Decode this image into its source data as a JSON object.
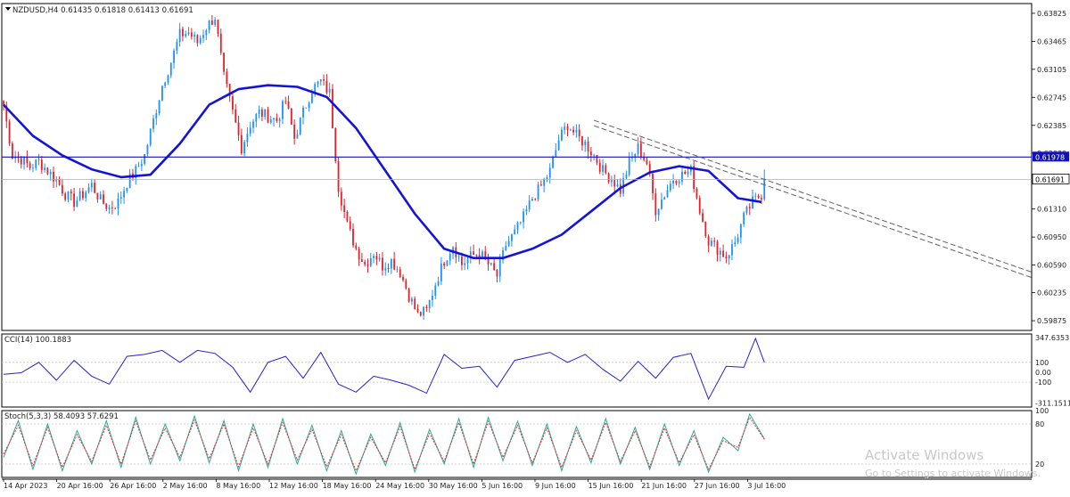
{
  "window": {
    "symbol_header": "NZDUSD,H4  0.61435 0.61818 0.61413 0.61691",
    "cci_header": "CCI(14) 100.1883",
    "stoch_header": "Stoch(5,3,3) 58.4093 57.6291"
  },
  "watermark": {
    "title": "Activate Windows",
    "subtitle": "Go to Settings to activate Windows."
  },
  "colors": {
    "bull": "#1e90ff",
    "bear": "#e8202a",
    "ma": "#1414d8",
    "hline": "#1010c0",
    "trendline": "#606060",
    "cci": "#2222cc",
    "stoch_main": "#2ea89a",
    "stoch_signal": "#e03030",
    "grid": "#c8c8c8",
    "text": "#222222"
  },
  "chart_data": [
    {
      "type": "candlestick",
      "name": "NZDUSD,H4",
      "ohlc_header": {
        "open": 0.61435,
        "high": 0.61818,
        "low": 0.61413,
        "close": 0.61691
      },
      "ylim": [
        0.5975,
        0.6395
      ],
      "y_ticks": [
        "0.63825",
        "0.63465",
        "0.63105",
        "0.62745",
        "0.62385",
        "0.62030",
        "0.61310",
        "0.60950",
        "0.60590",
        "0.60235",
        "0.59875"
      ],
      "x_labels": [
        "14 Apr 2023",
        "20 Apr 16:00",
        "26 Apr 16:00",
        "2 May 16:00",
        "8 May 16:00",
        "12 May 16:00",
        "18 May 16:00",
        "24 May 16:00",
        "30 May 16:00",
        "5 Jun 16:00",
        "9 Jun 16:00",
        "15 Jun 16:00",
        "21 Jun 16:00",
        "27 Jun 16:00",
        "3 Jul 16:00"
      ],
      "close_path": [
        [
          0,
          0.6264
        ],
        [
          3,
          0.62
        ],
        [
          6,
          0.6195
        ],
        [
          9,
          0.6185
        ],
        [
          12,
          0.6192
        ],
        [
          15,
          0.618
        ],
        [
          18,
          0.6168
        ],
        [
          21,
          0.615
        ],
        [
          24,
          0.614
        ],
        [
          27,
          0.615
        ],
        [
          30,
          0.6162
        ],
        [
          33,
          0.6142
        ],
        [
          36,
          0.6132
        ],
        [
          39,
          0.614
        ],
        [
          42,
          0.6165
        ],
        [
          45,
          0.618
        ],
        [
          48,
          0.62
        ],
        [
          51,
          0.6245
        ],
        [
          54,
          0.629
        ],
        [
          57,
          0.632
        ],
        [
          60,
          0.6355
        ],
        [
          63,
          0.6358
        ],
        [
          66,
          0.6345
        ],
        [
          69,
          0.6365
        ],
        [
          72,
          0.6378
        ],
        [
          75,
          0.63
        ],
        [
          78,
          0.6255
        ],
        [
          81,
          0.621
        ],
        [
          84,
          0.624
        ],
        [
          87,
          0.6255
        ],
        [
          90,
          0.625
        ],
        [
          93,
          0.6245
        ],
        [
          96,
          0.627
        ],
        [
          99,
          0.6222
        ],
        [
          102,
          0.6255
        ],
        [
          105,
          0.6285
        ],
        [
          108,
          0.6295
        ],
        [
          111,
          0.628
        ],
        [
          114,
          0.616
        ],
        [
          117,
          0.611
        ],
        [
          120,
          0.608
        ],
        [
          123,
          0.606
        ],
        [
          126,
          0.6075
        ],
        [
          129,
          0.6058
        ],
        [
          132,
          0.6065
        ],
        [
          135,
          0.605
        ],
        [
          138,
          0.602
        ],
        [
          141,
          0.5995
        ],
        [
          144,
          0.6
        ],
        [
          147,
          0.6035
        ],
        [
          150,
          0.6065
        ],
        [
          153,
          0.6085
        ],
        [
          156,
          0.606
        ],
        [
          159,
          0.607
        ],
        [
          162,
          0.6075
        ],
        [
          165,
          0.606
        ],
        [
          168,
          0.6045
        ],
        [
          171,
          0.6085
        ],
        [
          174,
          0.61
        ],
        [
          177,
          0.612
        ],
        [
          180,
          0.6145
        ],
        [
          183,
          0.616
        ],
        [
          186,
          0.618
        ],
        [
          189,
          0.622
        ],
        [
          192,
          0.624
        ],
        [
          195,
          0.6225
        ],
        [
          198,
          0.6215
        ],
        [
          201,
          0.62
        ],
        [
          204,
          0.618
        ],
        [
          207,
          0.617
        ],
        [
          210,
          0.6155
        ],
        [
          213,
          0.619
        ],
        [
          216,
          0.621
        ],
        [
          219,
          0.619
        ],
        [
          222,
          0.613
        ],
        [
          225,
          0.615
        ],
        [
          228,
          0.617
        ],
        [
          231,
          0.6175
        ],
        [
          234,
          0.618
        ],
        [
          237,
          0.613
        ],
        [
          240,
          0.609
        ],
        [
          243,
          0.608
        ],
        [
          246,
          0.607
        ],
        [
          249,
          0.6088
        ],
        [
          252,
          0.612
        ],
        [
          255,
          0.614
        ],
        [
          258,
          0.615
        ],
        [
          259,
          0.6169
        ]
      ],
      "moving_average": [
        [
          0,
          0.6265
        ],
        [
          10,
          0.6225
        ],
        [
          20,
          0.62
        ],
        [
          30,
          0.6182
        ],
        [
          40,
          0.6172
        ],
        [
          50,
          0.6175
        ],
        [
          60,
          0.6215
        ],
        [
          70,
          0.6265
        ],
        [
          80,
          0.6285
        ],
        [
          90,
          0.629
        ],
        [
          100,
          0.6288
        ],
        [
          110,
          0.6275
        ],
        [
          120,
          0.6235
        ],
        [
          130,
          0.618
        ],
        [
          140,
          0.6125
        ],
        [
          150,
          0.608
        ],
        [
          160,
          0.6068
        ],
        [
          170,
          0.6068
        ],
        [
          180,
          0.608
        ],
        [
          190,
          0.6098
        ],
        [
          200,
          0.6128
        ],
        [
          210,
          0.6158
        ],
        [
          220,
          0.6178
        ],
        [
          230,
          0.6186
        ],
        [
          240,
          0.618
        ],
        [
          250,
          0.6145
        ],
        [
          258,
          0.614
        ]
      ],
      "horizontal_line": {
        "value": 0.61978,
        "label": "0.61978"
      },
      "current_price": {
        "value": 0.61691,
        "label": "0.61691"
      },
      "trendlines": [
        {
          "from": [
            201,
            0.6245
          ],
          "to": [
            350,
            0.605
          ]
        },
        {
          "from": [
            201,
            0.6238
          ],
          "to": [
            350,
            0.6043
          ]
        }
      ]
    },
    {
      "type": "line",
      "name": "CCI(14)",
      "current": 100.1883,
      "ylim": [
        -350,
        385
      ],
      "y_ticks": [
        "347.6353",
        "100",
        "0.00",
        "-100",
        "-311.1511"
      ],
      "levels": [
        100,
        -100
      ],
      "values": [
        [
          0,
          -20
        ],
        [
          6,
          -5
        ],
        [
          12,
          100
        ],
        [
          18,
          -80
        ],
        [
          24,
          120
        ],
        [
          30,
          -40
        ],
        [
          36,
          -120
        ],
        [
          42,
          160
        ],
        [
          48,
          180
        ],
        [
          54,
          220
        ],
        [
          60,
          100
        ],
        [
          66,
          220
        ],
        [
          72,
          190
        ],
        [
          78,
          50
        ],
        [
          84,
          -200
        ],
        [
          90,
          100
        ],
        [
          96,
          160
        ],
        [
          102,
          -60
        ],
        [
          108,
          200
        ],
        [
          114,
          -120
        ],
        [
          120,
          -200
        ],
        [
          126,
          -40
        ],
        [
          132,
          -80
        ],
        [
          138,
          -130
        ],
        [
          144,
          -210
        ],
        [
          150,
          180
        ],
        [
          156,
          40
        ],
        [
          162,
          60
        ],
        [
          168,
          -150
        ],
        [
          174,
          120
        ],
        [
          180,
          160
        ],
        [
          186,
          200
        ],
        [
          192,
          100
        ],
        [
          198,
          180
        ],
        [
          204,
          30
        ],
        [
          210,
          -90
        ],
        [
          216,
          110
        ],
        [
          222,
          -60
        ],
        [
          228,
          150
        ],
        [
          234,
          190
        ],
        [
          240,
          -270
        ],
        [
          246,
          60
        ],
        [
          252,
          50
        ],
        [
          256,
          340
        ],
        [
          259,
          100
        ]
      ]
    },
    {
      "type": "line",
      "name": "Stoch(5,3,3)",
      "main": 58.4093,
      "signal": 57.6291,
      "ylim": [
        0,
        100
      ],
      "y_ticks": [
        "100",
        "80",
        "20"
      ],
      "levels": [
        80,
        20
      ],
      "main_values": [
        [
          0,
          30
        ],
        [
          5,
          85
        ],
        [
          10,
          12
        ],
        [
          15,
          80
        ],
        [
          20,
          10
        ],
        [
          25,
          70
        ],
        [
          30,
          20
        ],
        [
          35,
          85
        ],
        [
          40,
          15
        ],
        [
          45,
          90
        ],
        [
          50,
          20
        ],
        [
          55,
          80
        ],
        [
          60,
          25
        ],
        [
          65,
          92
        ],
        [
          70,
          22
        ],
        [
          75,
          85
        ],
        [
          80,
          10
        ],
        [
          85,
          80
        ],
        [
          90,
          15
        ],
        [
          95,
          88
        ],
        [
          100,
          20
        ],
        [
          105,
          78
        ],
        [
          110,
          10
        ],
        [
          115,
          70
        ],
        [
          120,
          5
        ],
        [
          125,
          65
        ],
        [
          130,
          18
        ],
        [
          135,
          82
        ],
        [
          140,
          8
        ],
        [
          145,
          72
        ],
        [
          150,
          20
        ],
        [
          155,
          88
        ],
        [
          160,
          15
        ],
        [
          165,
          90
        ],
        [
          170,
          25
        ],
        [
          175,
          84
        ],
        [
          180,
          18
        ],
        [
          185,
          80
        ],
        [
          190,
          10
        ],
        [
          195,
          76
        ],
        [
          200,
          22
        ],
        [
          205,
          88
        ],
        [
          210,
          20
        ],
        [
          215,
          75
        ],
        [
          220,
          12
        ],
        [
          225,
          80
        ],
        [
          230,
          18
        ],
        [
          235,
          70
        ],
        [
          240,
          8
        ],
        [
          245,
          60
        ],
        [
          250,
          40
        ],
        [
          254,
          95
        ],
        [
          259,
          58
        ]
      ],
      "signal_values": [
        [
          0,
          35
        ],
        [
          5,
          78
        ],
        [
          10,
          18
        ],
        [
          15,
          75
        ],
        [
          20,
          15
        ],
        [
          25,
          64
        ],
        [
          30,
          24
        ],
        [
          35,
          78
        ],
        [
          40,
          20
        ],
        [
          45,
          84
        ],
        [
          50,
          26
        ],
        [
          55,
          74
        ],
        [
          60,
          30
        ],
        [
          65,
          86
        ],
        [
          70,
          28
        ],
        [
          75,
          80
        ],
        [
          80,
          16
        ],
        [
          85,
          74
        ],
        [
          90,
          20
        ],
        [
          95,
          82
        ],
        [
          100,
          26
        ],
        [
          105,
          72
        ],
        [
          110,
          16
        ],
        [
          115,
          64
        ],
        [
          120,
          10
        ],
        [
          125,
          60
        ],
        [
          130,
          22
        ],
        [
          135,
          76
        ],
        [
          140,
          12
        ],
        [
          145,
          66
        ],
        [
          150,
          24
        ],
        [
          155,
          82
        ],
        [
          160,
          20
        ],
        [
          165,
          84
        ],
        [
          170,
          30
        ],
        [
          175,
          78
        ],
        [
          180,
          22
        ],
        [
          185,
          74
        ],
        [
          190,
          15
        ],
        [
          195,
          70
        ],
        [
          200,
          26
        ],
        [
          205,
          82
        ],
        [
          210,
          24
        ],
        [
          215,
          70
        ],
        [
          220,
          16
        ],
        [
          225,
          74
        ],
        [
          230,
          22
        ],
        [
          235,
          64
        ],
        [
          240,
          12
        ],
        [
          245,
          55
        ],
        [
          250,
          45
        ],
        [
          254,
          90
        ],
        [
          259,
          57
        ]
      ]
    }
  ]
}
